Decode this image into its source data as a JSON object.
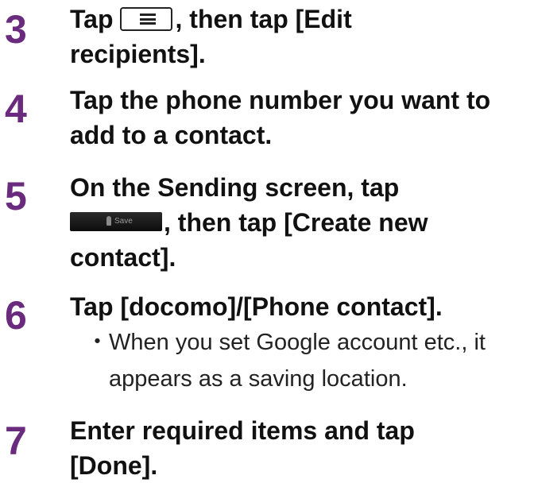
{
  "steps": [
    {
      "number": "3",
      "line1_before": "Tap",
      "menu_icon": "menu-key-icon",
      "line1_after": ", then tap [Edit",
      "line2": "recipients]."
    },
    {
      "number": "4",
      "line1": "Tap the phone number you want to",
      "line2": "add to a contact."
    },
    {
      "number": "5",
      "line1": "On the Sending screen, tap",
      "save_icon": "save-contact-button-icon",
      "save_icon_label": "Save",
      "line2_after": ", then tap [Create new",
      "line3": "contact]."
    },
    {
      "number": "6",
      "line1": "Tap [docomo]/[Phone contact].",
      "note_bullet": "・",
      "note_line1": "When you set Google account etc., it",
      "note_line2": "appears as a saving location."
    },
    {
      "number": "7",
      "line1": "Enter required items and tap",
      "line2": "[Done]."
    }
  ],
  "colors": {
    "step_number": "#6a2a7d",
    "text": "#111111"
  }
}
